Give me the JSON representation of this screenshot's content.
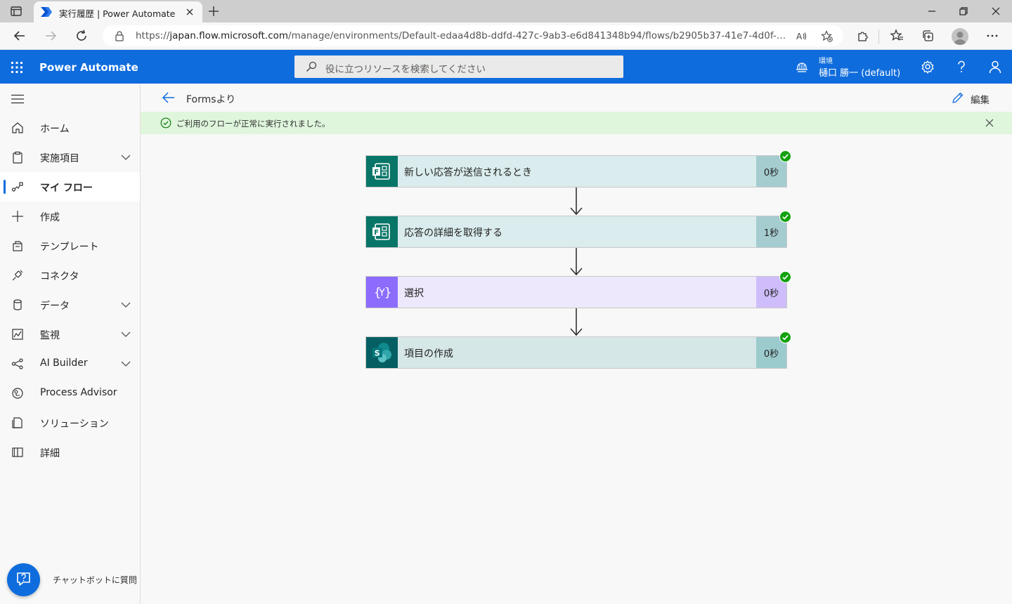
{
  "browser": {
    "tab_title": "実行履歴 | Power Automate",
    "url_prefix": "https://",
    "url_host": "japan.flow.microsoft.com",
    "url_path": "/manage/environments/Default-edaa4d8b-ddfd-427c-9ab3-e6d841348b94/flows/b2905b37-41e7-4d0f-921a-08dcc..."
  },
  "header": {
    "app_title": "Power Automate",
    "search_placeholder": "役に立つリソースを検索してください",
    "env_label": "環境",
    "env_name": "樋口 勝一 (default)",
    "accent": "#0f6cdd"
  },
  "sidebar": {
    "items": [
      {
        "label": "ホーム",
        "icon": "home-icon",
        "expandable": false
      },
      {
        "label": "実施項目",
        "icon": "clipboard-icon",
        "expandable": true
      },
      {
        "label": "マイ フロー",
        "icon": "flow-icon",
        "expandable": false,
        "active": true
      },
      {
        "label": "作成",
        "icon": "plus-icon",
        "expandable": false
      },
      {
        "label": "テンプレート",
        "icon": "template-icon",
        "expandable": false
      },
      {
        "label": "コネクタ",
        "icon": "connector-icon",
        "expandable": false
      },
      {
        "label": "データ",
        "icon": "database-icon",
        "expandable": true
      },
      {
        "label": "監視",
        "icon": "chart-icon",
        "expandable": true
      },
      {
        "label": "AI Builder",
        "icon": "ai-builder-icon",
        "expandable": true
      },
      {
        "label": "Process Advisor",
        "icon": "process-advisor-icon",
        "expandable": false
      },
      {
        "label": "ソリューション",
        "icon": "solution-icon",
        "expandable": false
      },
      {
        "label": "詳細",
        "icon": "book-icon",
        "expandable": false
      }
    ],
    "chatbot_label": "チャットボットに質問"
  },
  "main": {
    "flow_name": "Formsより",
    "edit_label": "編集",
    "message": "ご利用のフローが正常に実行されました。",
    "message_color": "#dff6dd",
    "steps": [
      {
        "label": "新しい応答が送信されるとき",
        "duration": "0秒",
        "icon": "forms-icon",
        "status": "succeeded"
      },
      {
        "label": "応答の詳細を取得する",
        "duration": "1秒",
        "icon": "forms-icon",
        "status": "succeeded"
      },
      {
        "label": "選択",
        "duration": "0秒",
        "icon": "data-operation-icon",
        "status": "succeeded"
      },
      {
        "label": "項目の作成",
        "duration": "0秒",
        "icon": "sharepoint-icon",
        "status": "succeeded"
      }
    ]
  }
}
